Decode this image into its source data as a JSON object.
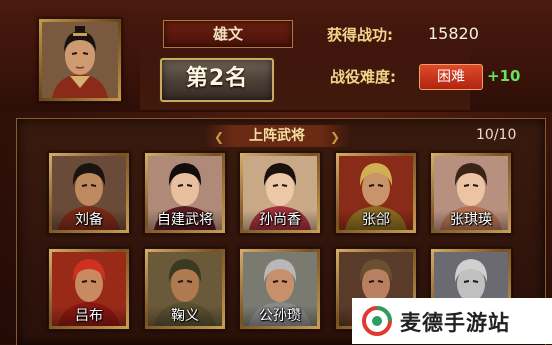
{
  "player": {
    "name": "雄文",
    "rank": "第2名",
    "portrait_icon": "commander-portrait-icon"
  },
  "stats": {
    "merit_label": "获得战功:",
    "merit_value": "15820",
    "difficulty_label": "战役难度:",
    "difficulty_value": "困难",
    "difficulty_bonus": "+10"
  },
  "lineup": {
    "title": "上阵武将",
    "count": "10/10",
    "generals": [
      {
        "name": "刘备",
        "skin": "#c08a60",
        "robe": "#7a2a18",
        "hair": "#1a1410",
        "bg": "#6a4a38"
      },
      {
        "name": "自建武将",
        "skin": "#e8c0a0",
        "robe": "#5a1a20",
        "hair": "#120c0a",
        "bg": "#b08a78"
      },
      {
        "name": "孙尚香",
        "skin": "#ecc8a8",
        "robe": "#a0303a",
        "hair": "#1a100c",
        "bg": "#c9a888"
      },
      {
        "name": "张郃",
        "skin": "#c8946a",
        "robe": "#8a6a20",
        "hair": "#d0b050",
        "bg": "#8a2a18"
      },
      {
        "name": "张琪瑛",
        "skin": "#ecc4a4",
        "robe": "#b07050",
        "hair": "#3a2418",
        "bg": "#b89080"
      },
      {
        "name": "吕布",
        "skin": "#c88a60",
        "robe": "#8a1810",
        "hair": "#d03020",
        "bg": "#9a2a18"
      },
      {
        "name": "鞠义",
        "skin": "#b07a50",
        "robe": "#5a5030",
        "hair": "#3a3a20",
        "bg": "#6a5a3a"
      },
      {
        "name": "公孙瓒",
        "skin": "#c8906a",
        "robe": "#8a8a8a",
        "hair": "#b8b8b8",
        "bg": "#7a7a70"
      },
      {
        "name": "",
        "skin": "#b88060",
        "robe": "#6a3a20",
        "hair": "#6a5030",
        "bg": "#5a3a28"
      },
      {
        "name": "",
        "skin": "#c0c0c0",
        "robe": "#8a8a90",
        "hair": "#d0d0d0",
        "bg": "#6a6a70"
      }
    ]
  },
  "watermark": {
    "text": "麦德手游站",
    "logo_icon": "mde-logo-icon"
  }
}
